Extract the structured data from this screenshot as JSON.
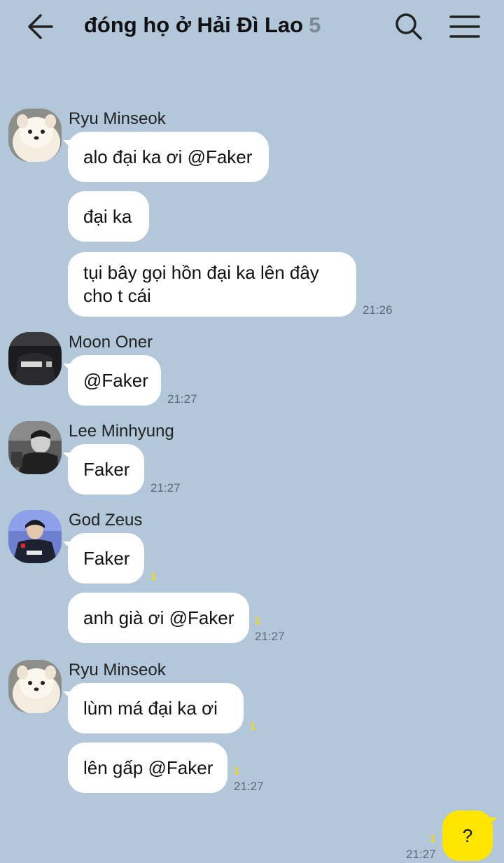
{
  "header": {
    "title": "đóng họ ở Hải Đì Lao",
    "member_count": "5"
  },
  "messages": [
    {
      "sender": "Ryu Minseok",
      "avatar": "pomeranian-dog-avatar",
      "bubbles": [
        "alo đại ka ơi @Faker",
        "đại ka",
        "tụi bây gọi hồn đại ka lên đây cho t cái"
      ],
      "time": "21:26"
    },
    {
      "sender": "Moon Oner",
      "avatar": "player-jersey-avatar",
      "bubbles": [
        "@Faker"
      ],
      "time": "21:27"
    },
    {
      "sender": "Lee Minhyung",
      "avatar": "player-photo-avatar",
      "bubbles": [
        "Faker"
      ],
      "time": "21:27"
    },
    {
      "sender": "God Zeus",
      "avatar": "player-team-jersey-avatar",
      "bubbles": [
        "Faker",
        "anh già ơi @Faker"
      ],
      "unread": [
        "1",
        "1"
      ],
      "time": "21:27"
    },
    {
      "sender": "Ryu Minseok",
      "avatar": "pomeranian-dog-avatar",
      "bubbles": [
        "lùm má đại ka ơi",
        "lên gấp @Faker"
      ],
      "unread": [
        "1",
        "1"
      ],
      "time": "21:27"
    }
  ],
  "my_message": {
    "text": "?",
    "unread": "1",
    "time": "21:27"
  },
  "colors": {
    "background": "#b2c7d9",
    "incoming_bubble": "#ffffff",
    "outgoing_bubble": "#fee500",
    "unread_count": "#ffd900"
  }
}
